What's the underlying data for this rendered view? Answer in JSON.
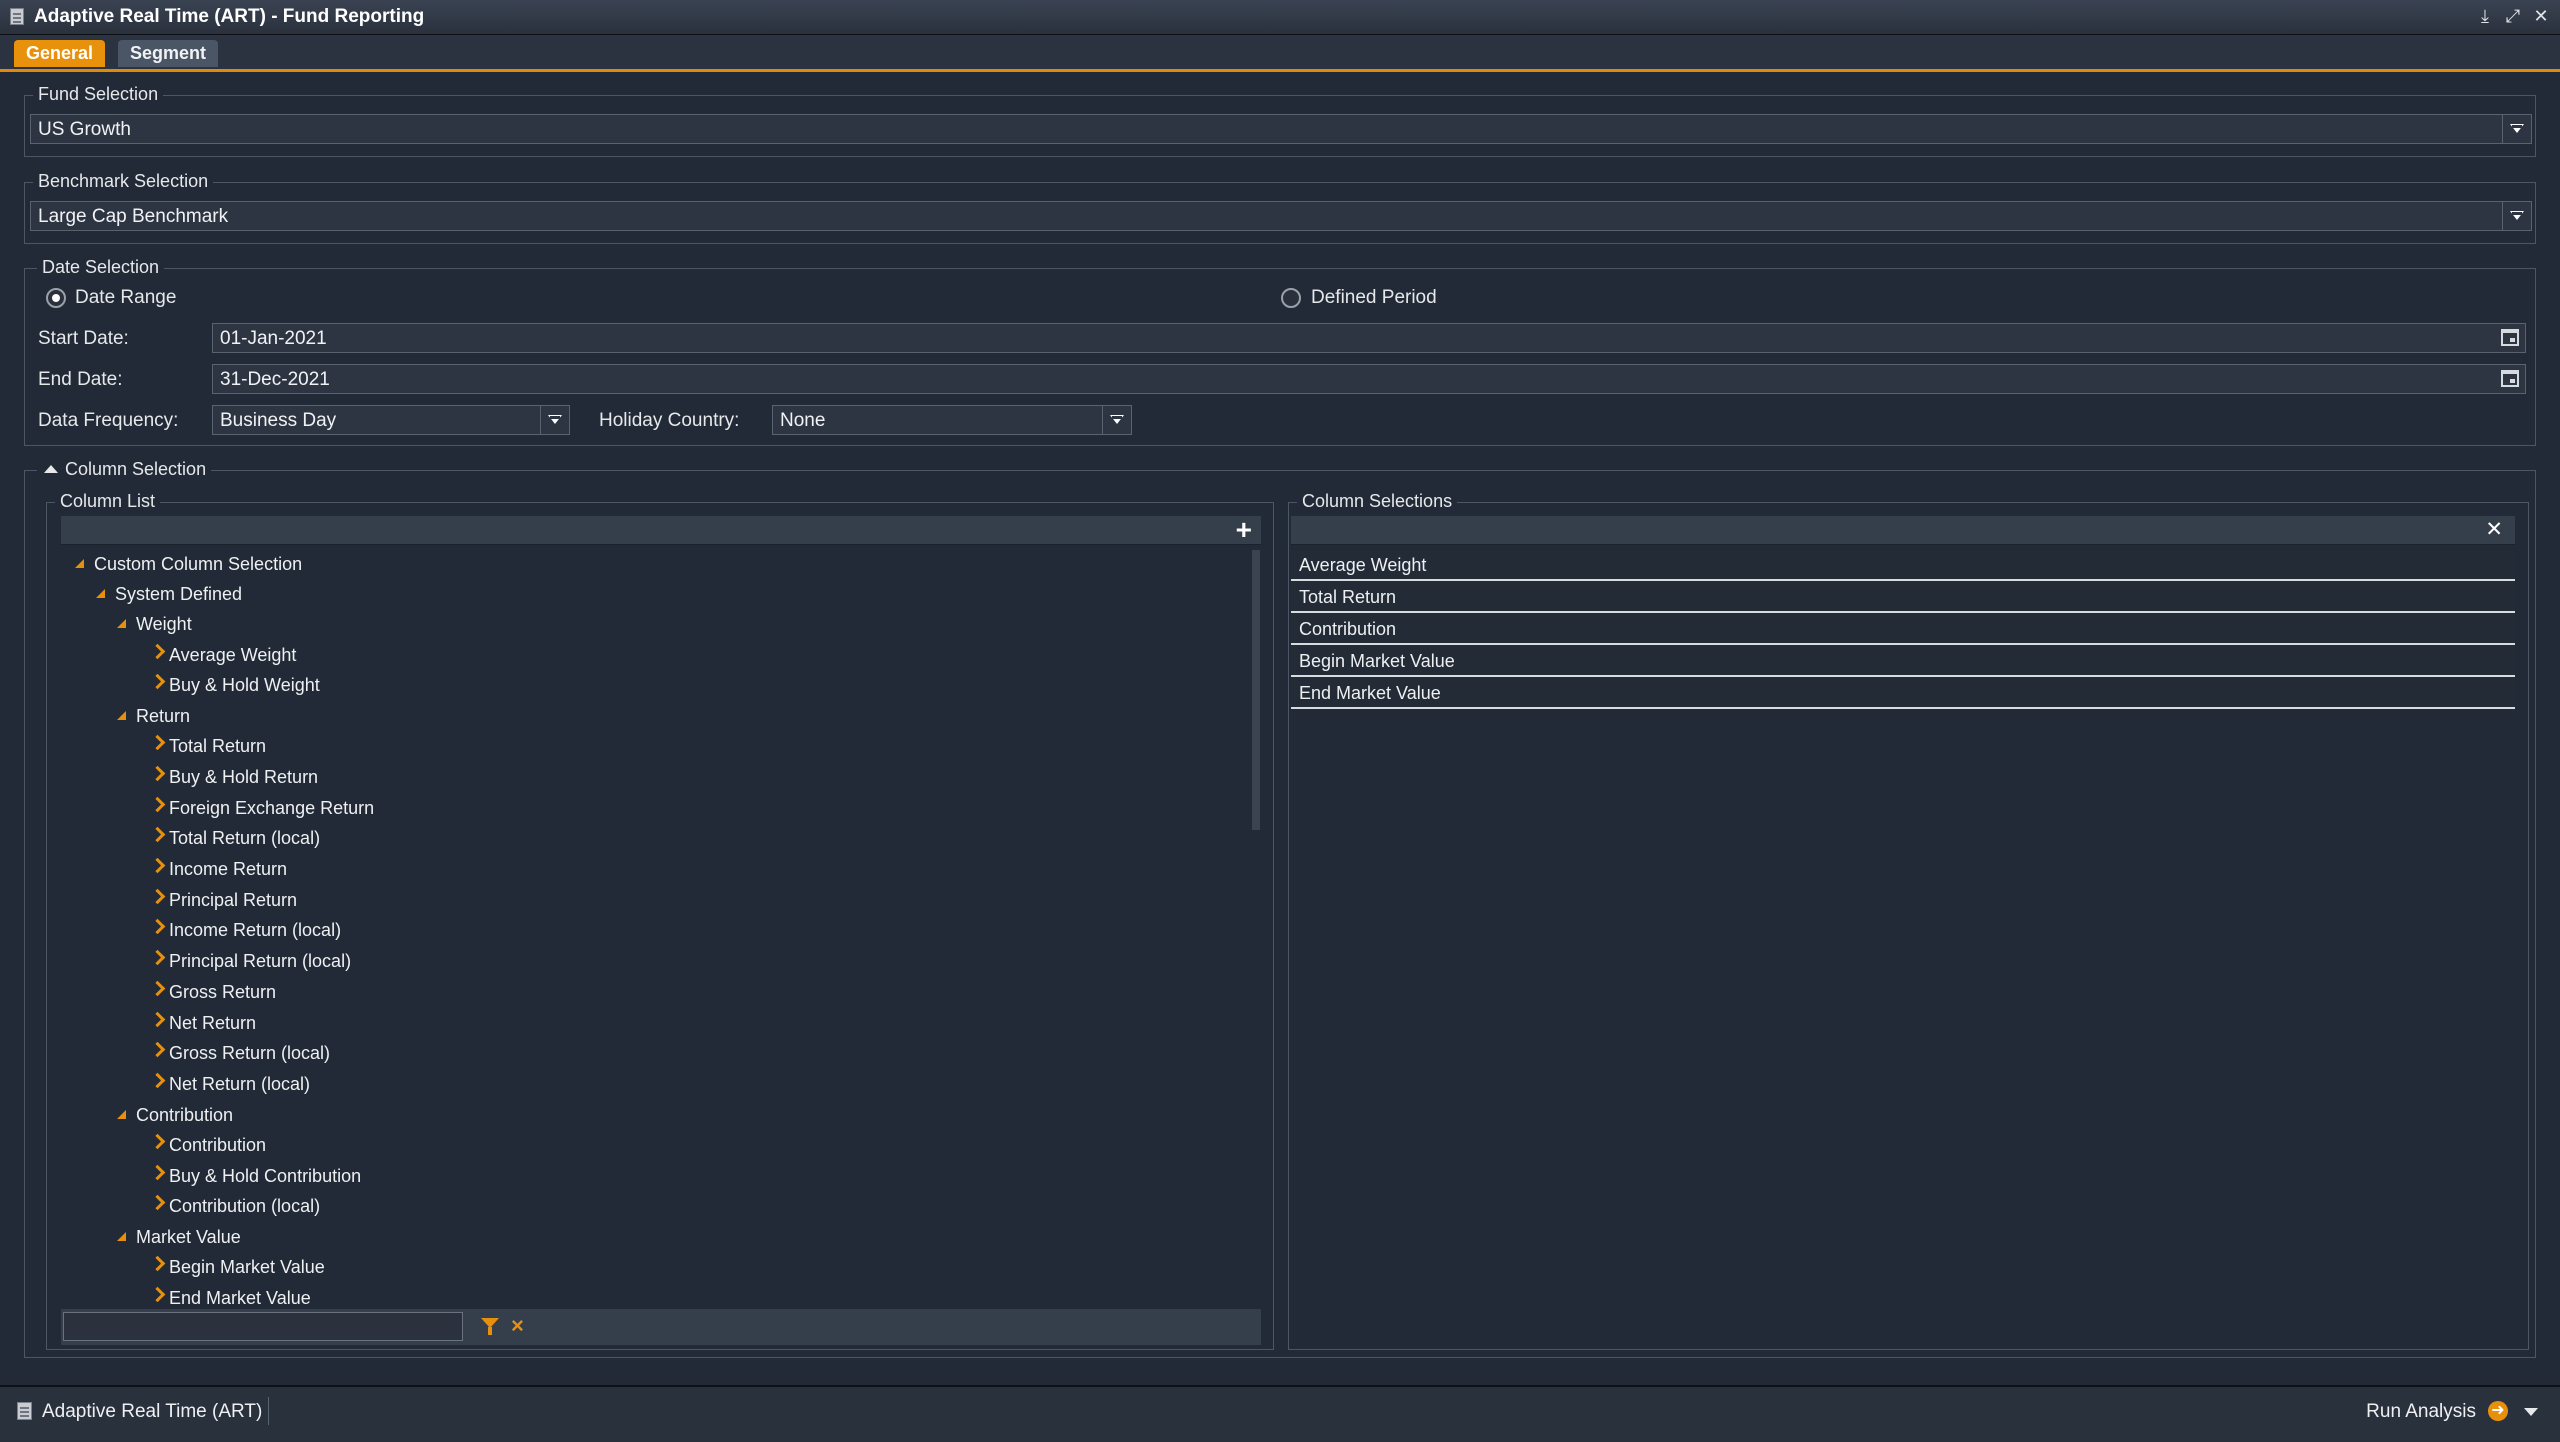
{
  "window": {
    "title": "Adaptive Real Time (ART) - Fund Reporting",
    "controls": [
      "download-icon",
      "restore-icon",
      "close-icon"
    ]
  },
  "tabs": [
    {
      "label": "General",
      "active": true
    },
    {
      "label": "Segment",
      "active": false
    }
  ],
  "fund_selection": {
    "legend": "Fund Selection",
    "value": "US Growth"
  },
  "benchmark_selection": {
    "legend": "Benchmark Selection",
    "value": "Large Cap Benchmark"
  },
  "date_selection": {
    "legend": "Date Selection",
    "radio_date_range": "Date Range",
    "radio_defined_period": "Defined Period",
    "selected": "Date Range",
    "start_label": "Start Date:",
    "start_value": "01-Jan-2021",
    "end_label": "End Date:",
    "end_value": "31-Dec-2021",
    "frequency_label": "Data Frequency:",
    "frequency_value": "Business Day",
    "holiday_label": "Holiday Country:",
    "holiday_value": "None"
  },
  "column_selection": {
    "legend": "Column Selection",
    "column_list": {
      "legend": "Column List",
      "add_icon": "+",
      "tree": [
        {
          "level": 0,
          "type": "group",
          "label": "Custom Column Selection"
        },
        {
          "level": 1,
          "type": "group",
          "label": "System Defined"
        },
        {
          "level": 2,
          "type": "group",
          "label": "Weight"
        },
        {
          "level": 3,
          "type": "item",
          "label": "Average Weight"
        },
        {
          "level": 3,
          "type": "item",
          "label": "Buy & Hold Weight"
        },
        {
          "level": 2,
          "type": "group",
          "label": "Return"
        },
        {
          "level": 3,
          "type": "item",
          "label": "Total Return"
        },
        {
          "level": 3,
          "type": "item",
          "label": "Buy & Hold Return"
        },
        {
          "level": 3,
          "type": "item",
          "label": "Foreign Exchange Return"
        },
        {
          "level": 3,
          "type": "item",
          "label": "Total Return (local)"
        },
        {
          "level": 3,
          "type": "item",
          "label": "Income Return"
        },
        {
          "level": 3,
          "type": "item",
          "label": "Principal Return"
        },
        {
          "level": 3,
          "type": "item",
          "label": "Income Return (local)"
        },
        {
          "level": 3,
          "type": "item",
          "label": "Principal Return (local)"
        },
        {
          "level": 3,
          "type": "item",
          "label": "Gross Return"
        },
        {
          "level": 3,
          "type": "item",
          "label": "Net Return"
        },
        {
          "level": 3,
          "type": "item",
          "label": "Gross Return (local)"
        },
        {
          "level": 3,
          "type": "item",
          "label": "Net Return (local)"
        },
        {
          "level": 2,
          "type": "group",
          "label": "Contribution"
        },
        {
          "level": 3,
          "type": "item",
          "label": "Contribution"
        },
        {
          "level": 3,
          "type": "item",
          "label": "Buy & Hold Contribution"
        },
        {
          "level": 3,
          "type": "item",
          "label": "Contribution (local)"
        },
        {
          "level": 2,
          "type": "group",
          "label": "Market Value"
        },
        {
          "level": 3,
          "type": "item",
          "label": "Begin Market Value"
        },
        {
          "level": 3,
          "type": "item",
          "label": "End Market Value"
        }
      ],
      "filter_value": ""
    },
    "column_selections": {
      "legend": "Column Selections",
      "clear_icon": "✕",
      "items": [
        "Average Weight",
        "Total Return",
        "Contribution",
        "Begin Market Value",
        "End Market Value"
      ]
    }
  },
  "statusbar": {
    "app_name": "Adaptive Real Time (ART)",
    "run_label": "Run Analysis"
  },
  "colors": {
    "accent": "#e8910c",
    "background": "#212a36"
  }
}
